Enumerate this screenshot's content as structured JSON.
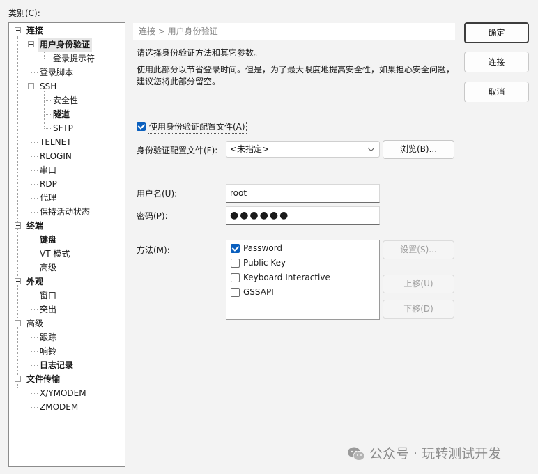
{
  "category_label": "类别(C):",
  "tree": {
    "connection": "连接",
    "auth": "用户身份验证",
    "login_prompt": "登录提示符",
    "login_script": "登录脚本",
    "ssh": "SSH",
    "security": "安全性",
    "tunnel": "隧道",
    "sftp": "SFTP",
    "telnet": "TELNET",
    "rlogin": "RLOGIN",
    "serial": "串口",
    "rdp": "RDP",
    "proxy": "代理",
    "keepalive": "保持活动状态",
    "terminal": "终端",
    "keyboard": "键盘",
    "vt_mode": "VT 模式",
    "advanced_t": "高级",
    "appearance": "外观",
    "window": "窗口",
    "highlight": "突出",
    "advanced": "高级",
    "trace": "跟踪",
    "bell": "响铃",
    "logging": "日志记录",
    "file_transfer": "文件传输",
    "xymodem": "X/YMODEM",
    "zmodem": "ZMODEM"
  },
  "breadcrumb": "连接 > 用户身份验证",
  "desc1": "请选择身份验证方法和其它参数。",
  "desc2_l1": "使用此部分以节省登录时间。但是，为了最大限度地提高安全性，如果担心安全问题，",
  "desc2_l2": "建议您将此部分留空。",
  "use_profile": {
    "label": "使用身份验证配置文件(A)",
    "checked": true
  },
  "profile": {
    "label": "身份验证配置文件(F):",
    "value": "<未指定>",
    "browse": "浏览(B)..."
  },
  "username": {
    "label": "用户名(U):",
    "value": "root"
  },
  "password": {
    "label": "密码(P):",
    "value": "●●●●●●"
  },
  "method": {
    "label": "方法(M):",
    "items": [
      {
        "label": "Password",
        "checked": true
      },
      {
        "label": "Public Key",
        "checked": false
      },
      {
        "label": "Keyboard Interactive",
        "checked": false
      },
      {
        "label": "GSSAPI",
        "checked": false
      }
    ],
    "settings": "设置(S)...",
    "move_up": "上移(U)",
    "move_down": "下移(D)"
  },
  "buttons": {
    "ok": "确定",
    "connect": "连接",
    "cancel": "取消"
  },
  "watermark": "公众号 · 玩转测试开发",
  "colors": {
    "accent": "#0a5fbe",
    "window_bg": "#f3f3f3"
  }
}
